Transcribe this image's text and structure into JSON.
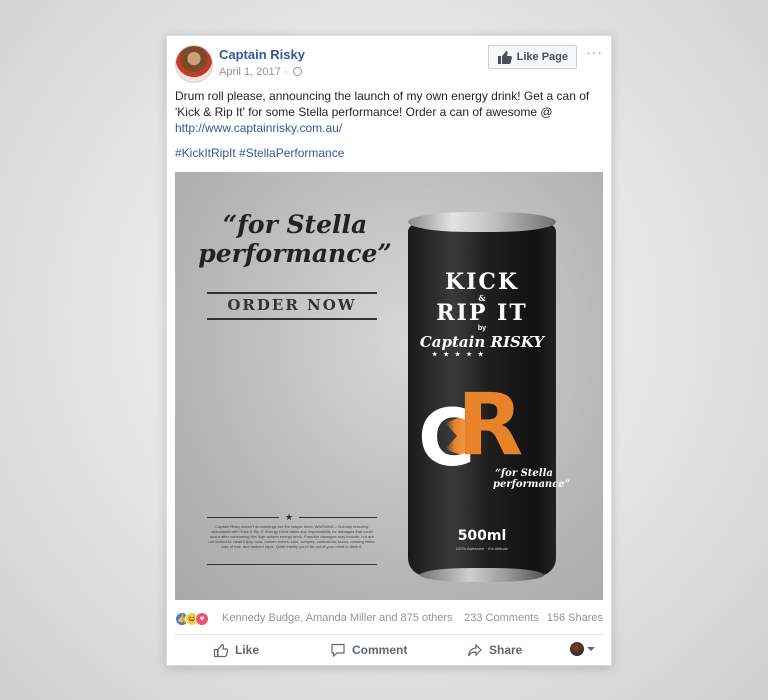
{
  "post": {
    "author": "Captain Risky",
    "date": "April 1, 2017 ·",
    "like_page_label": "Like Page",
    "more_label": "···",
    "text": "Drum roll please, announcing the launch of my own energy drink! Get a can of 'Kick & Rip It' for some Stella performance! Order a can of awesome @ ",
    "link": "http://www.captainrisky.com.au/",
    "hashtags": "#KickItRipIt #StellaPerformance"
  },
  "ad": {
    "slogan": "“for Stella performance”",
    "order_now": "ORDER NOW",
    "warning": "Captain Risky doesn't do warnings but the lawyer does: WARNING – Nobody remotely associated with \"Kick & Rip It\" Energy Drink takes any responsibility for damages that could occur after consuming this high octane energy drink. Possible damages may include, but are not limited to: head injury, cuts, broken bones, cuts, scrapes, contusions, burns, missing limbs, loss of hair, and bruised egos. Quite frankly you'd be out of your mind to drink it.",
    "can": {
      "line1": "KICK",
      "amp": "&",
      "line2": "RIP IT",
      "by": "by",
      "captain": "Captain RISKY",
      "stars": "★ ★ ★ ★ ★",
      "logo_c": "C",
      "logo_r": "R",
      "slogan": "“for Stella performance”",
      "volume": "500ml",
      "volume_sub": "100% Awesome · 0% Attitude"
    }
  },
  "engagement": {
    "names": "Kennedy Budge, Amanda Miller and 875 others",
    "comments": "233 Comments",
    "shares": "156 Shares"
  },
  "actions": {
    "like": "Like",
    "comment": "Comment",
    "share": "Share"
  },
  "colors": {
    "link_blue": "#365899",
    "accent_orange": "#e8832a",
    "text": "#1d2129",
    "muted": "#90949c"
  }
}
